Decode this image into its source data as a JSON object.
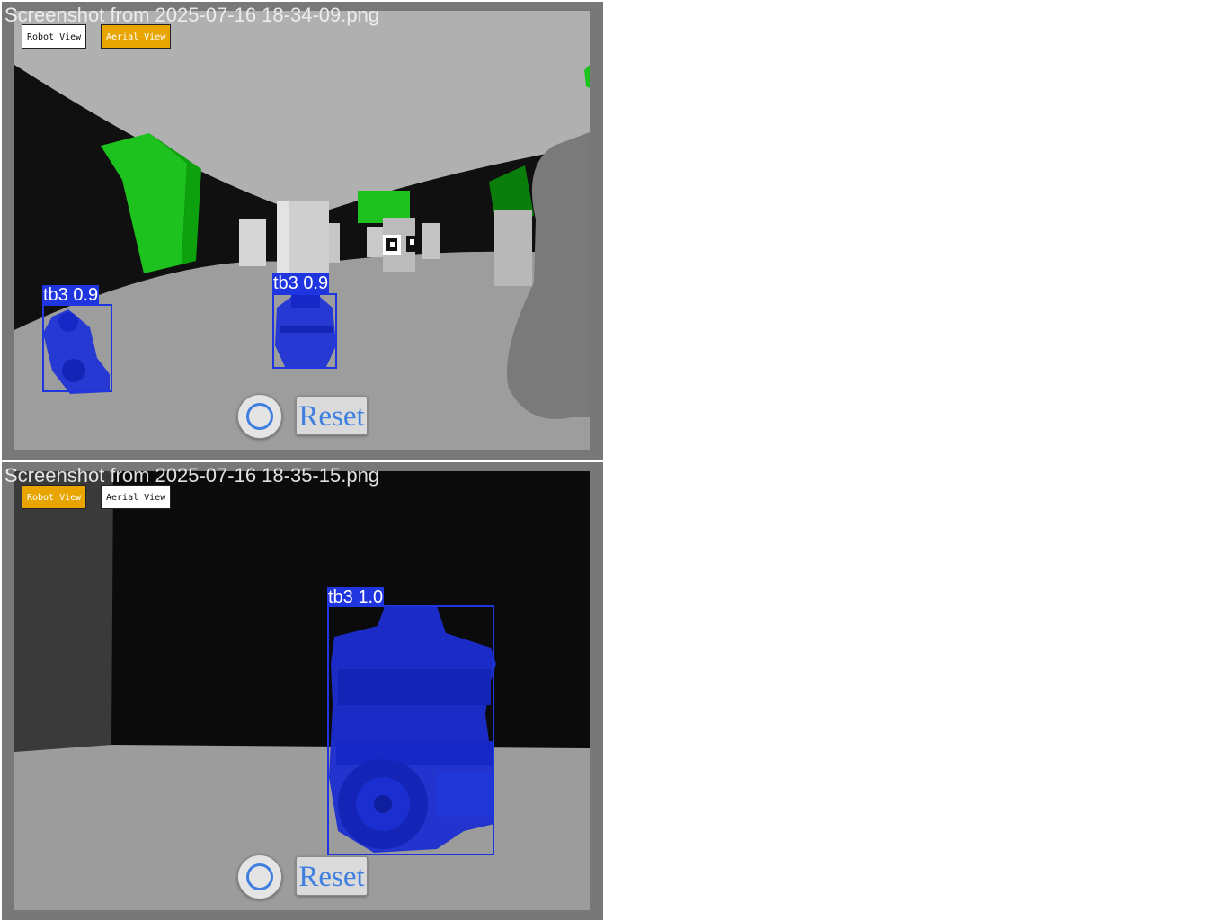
{
  "panels": [
    {
      "filename": "Screenshot from 2025-07-16 18-34-09.png",
      "buttons": {
        "robot_view": "Robot View",
        "aerial_view": "Aerial View"
      },
      "active_view": "aerial",
      "detections": [
        {
          "label": "tb3 0.9"
        },
        {
          "label": "tb3 0.9"
        }
      ],
      "controls": {
        "reset_label": "Reset"
      }
    },
    {
      "filename": "Screenshot from 2025-07-16 18-35-15.png",
      "buttons": {
        "robot_view": "Robot View",
        "aerial_view": "Aerial View"
      },
      "active_view": "robot",
      "detections": [
        {
          "label": "tb3 1.0"
        }
      ],
      "controls": {
        "reset_label": "Reset"
      }
    }
  ],
  "colors": {
    "active_button": "#e8a500",
    "detection": "#1f35e0",
    "control_accent": "#3f7fe0"
  }
}
